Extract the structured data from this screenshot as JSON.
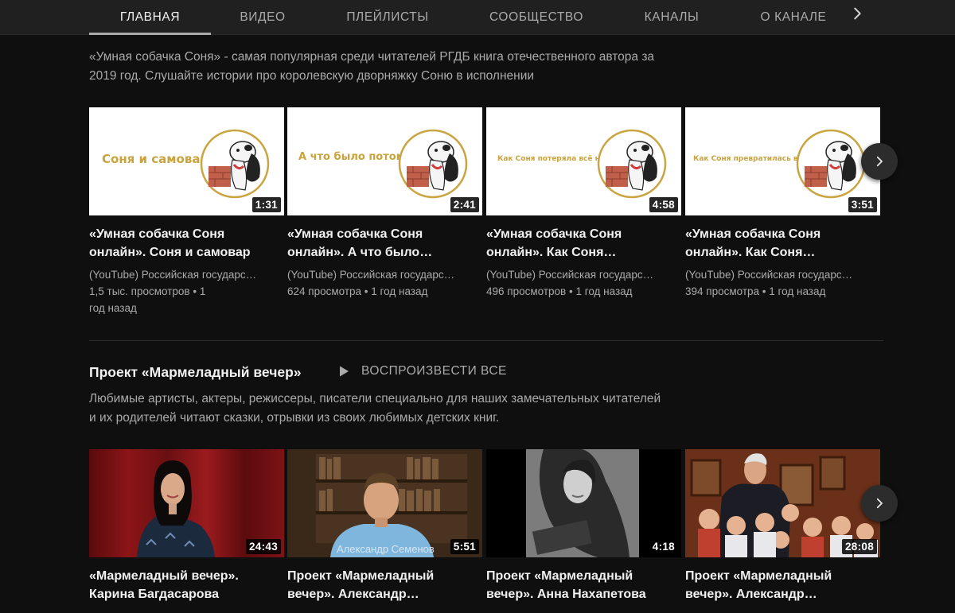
{
  "tabs": [
    {
      "label": "ГЛАВНАЯ",
      "active": true
    },
    {
      "label": "ВИДЕО",
      "active": false
    },
    {
      "label": "ПЛЕЙЛИСТЫ",
      "active": false
    },
    {
      "label": "СООБЩЕСТВО",
      "active": false
    },
    {
      "label": "КАНАЛЫ",
      "active": false
    },
    {
      "label": "О КАНАЛЕ",
      "active": false
    }
  ],
  "tab_next_icon": "chevron-right-icon",
  "shelf1": {
    "description": "«Умная собачка Соня» - самая популярная среди читателей РГДБ книга отечественного автора за 2019 год. Слушайте истории про королевскую дворняжку Соню в исполнении",
    "videos": [
      {
        "thumb_caption": "Соня и самовар",
        "duration": "1:31",
        "title": "«Умная собачка Соня онлайн». Соня и самовар",
        "channel": "(YouTube) Российская государственная детская библиотека",
        "meta": "1,5 тыс. просмотров • 1 год назад"
      },
      {
        "thumb_caption": "А что было потом?",
        "duration": "2:41",
        "title": "«Умная собачка Соня онлайн». А что было…",
        "channel": "(YouTube) Российская государственная детская библиотека",
        "meta": "624 просмотра • 1 год назад"
      },
      {
        "thumb_caption": "Как Соня потеряла всё на свете",
        "duration": "4:58",
        "title": "«Умная собачка Соня онлайн». Как Соня…",
        "channel": "(YouTube) Российская государственная детская библиотека",
        "meta": "496 просмотров • 1 год назад"
      },
      {
        "thumb_caption": "Как Соня превратилась в дерево",
        "duration": "3:51",
        "title": "«Умная собачка Соня онлайн». Как Соня…",
        "channel": "(YouTube) Российская государственная детская библиотека",
        "meta": "394 просмотра • 1 год назад"
      }
    ]
  },
  "shelf2": {
    "title": "Проект «Мармеладный вечер»",
    "play_all": "ВОСПРОИЗВЕСТИ ВСЕ",
    "description": "Любимые артисты, актеры, режиссеры, писатели специально для наших замечательных читателей и их родителей читают сказки, отрывки из своих любимых детских книг.",
    "videos": [
      {
        "duration": "24:43",
        "title": "«Мармеладный вечер». Карина Багдасарова"
      },
      {
        "duration": "5:51",
        "title": "Проект «Мармеладный вечер». Александр…",
        "overlay": "Александр Семенов"
      },
      {
        "duration": "4:18",
        "title": "Проект «Мармеладный вечер». Анна Нахапетова"
      },
      {
        "duration": "28:08",
        "title": "Проект «Мармеладный вечер». Александр…"
      }
    ]
  },
  "colors": {
    "background": "#0f0f0f",
    "tabbar": "#202020",
    "text_primary": "#f1f1f1",
    "text_secondary": "#aaaaaa",
    "sonya_gold": "#caa33c"
  }
}
